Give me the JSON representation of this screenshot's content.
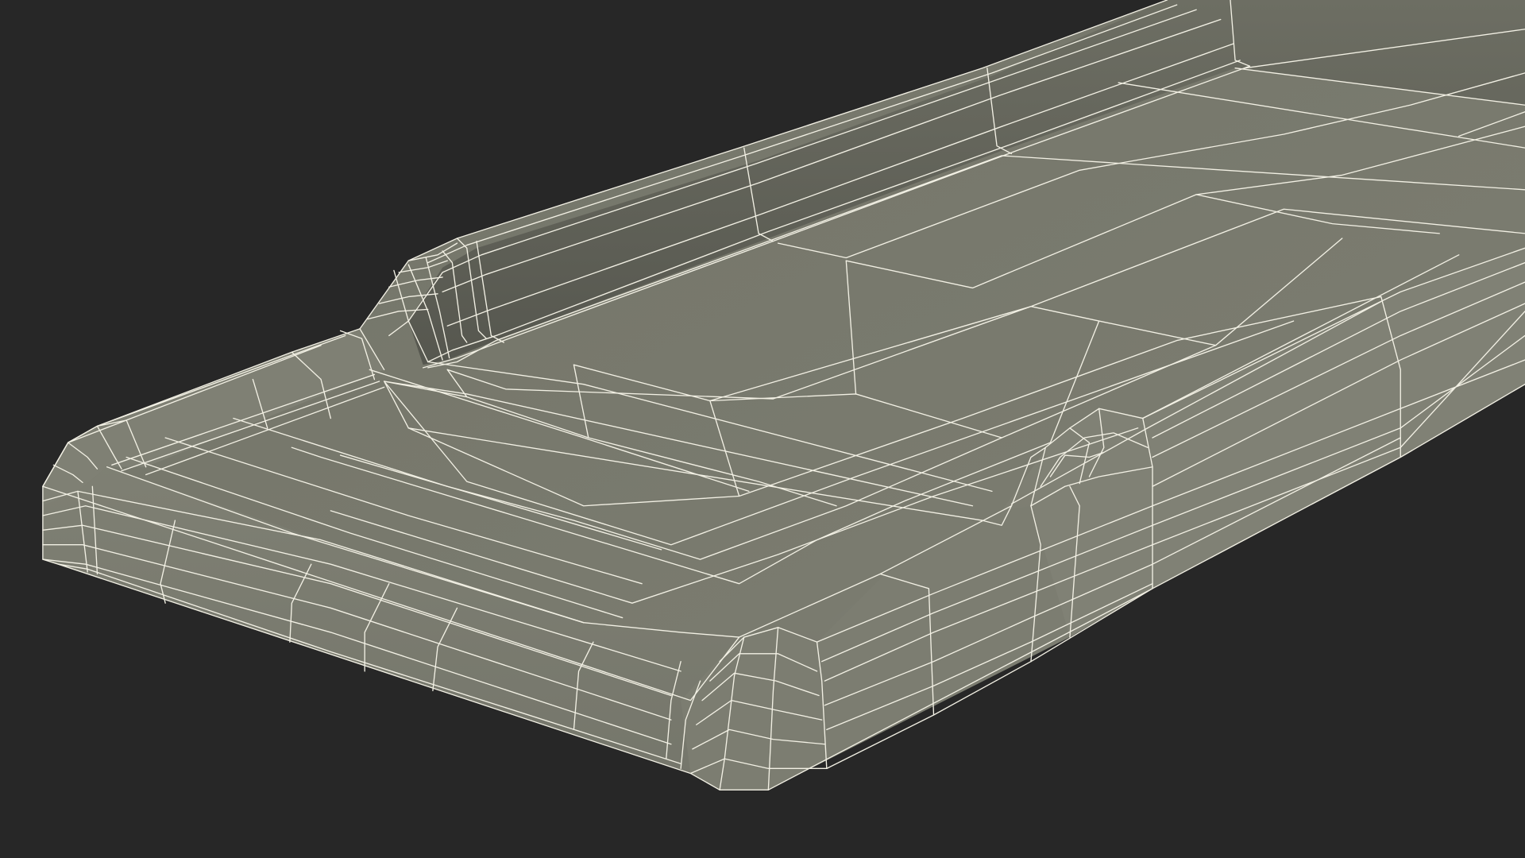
{
  "scene": {
    "subject": "wireframe-tray-model",
    "colors": {
      "background": "#272727",
      "surface": "#7a7b6e",
      "surface_shadow": "#5f6057",
      "surface_light": "#84857a",
      "wire": "#f2f0e4"
    }
  }
}
